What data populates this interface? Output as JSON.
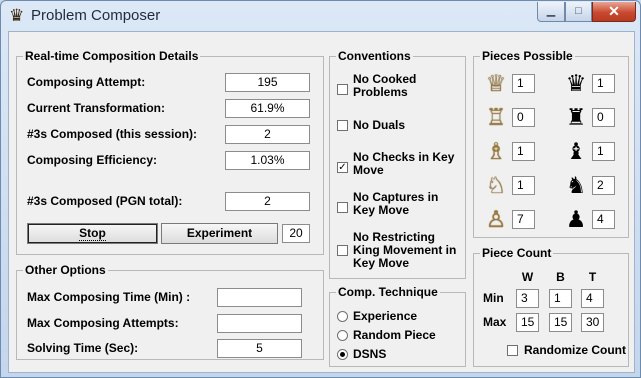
{
  "window": {
    "title": "Problem Composer",
    "icon": "chess-queen-icon"
  },
  "realtime": {
    "legend": "Real-time Composition Details",
    "rows": [
      {
        "label": "Composing Attempt:",
        "value": "195"
      },
      {
        "label": "Current Transformation:",
        "value": "61.9%"
      },
      {
        "label": "#3s Composed (this session):",
        "value": "2"
      },
      {
        "label": "Composing Efficiency:",
        "value": "1.03%"
      },
      {
        "label": "#3s Composed (PGN total):",
        "value": "2"
      }
    ],
    "stop_label": "Stop",
    "experiment_label": "Experiment",
    "experiment_value": "20"
  },
  "other": {
    "legend": "Other Options",
    "rows": [
      {
        "label": "Max Composing Time (Min) :",
        "value": ""
      },
      {
        "label": "Max Composing Attempts:",
        "value": ""
      },
      {
        "label": "Solving Time (Sec):",
        "value": "5"
      }
    ]
  },
  "conventions": {
    "legend": "Conventions",
    "items": [
      {
        "label": "No Cooked Problems",
        "checked": false
      },
      {
        "label": "No Duals",
        "checked": false
      },
      {
        "label": "No Checks in Key Move",
        "checked": true
      },
      {
        "label": "No Captures in Key Move",
        "checked": false
      },
      {
        "label": "No Restricting King Movement in Key Move",
        "checked": false
      }
    ]
  },
  "technique": {
    "legend": "Comp. Technique",
    "options": [
      {
        "label": "Experience",
        "selected": false
      },
      {
        "label": "Random Piece",
        "selected": false
      },
      {
        "label": "DSNS",
        "selected": true
      }
    ]
  },
  "pieces": {
    "legend": "Pieces Possible",
    "rows": [
      {
        "piece": "queen",
        "white_icon": "white-queen-icon",
        "white": "1",
        "black_icon": "black-queen-icon",
        "black": "1"
      },
      {
        "piece": "rook",
        "white_icon": "white-rook-icon",
        "white": "0",
        "black_icon": "black-rook-icon",
        "black": "0"
      },
      {
        "piece": "bishop",
        "white_icon": "white-bishop-icon",
        "white": "1",
        "black_icon": "black-bishop-icon",
        "black": "1"
      },
      {
        "piece": "knight",
        "white_icon": "white-knight-icon",
        "white": "1",
        "black_icon": "black-knight-icon",
        "black": "2"
      },
      {
        "piece": "pawn",
        "white_icon": "white-pawn-icon",
        "white": "7",
        "black_icon": "black-pawn-icon",
        "black": "4"
      }
    ]
  },
  "count": {
    "legend": "Piece Count",
    "headers": [
      "W",
      "B",
      "T"
    ],
    "min_label": "Min",
    "max_label": "Max",
    "min": [
      "3",
      "1",
      "4"
    ],
    "max": [
      "15",
      "15",
      "30"
    ],
    "randomize_label": "Randomize Count",
    "randomize_checked": false
  }
}
